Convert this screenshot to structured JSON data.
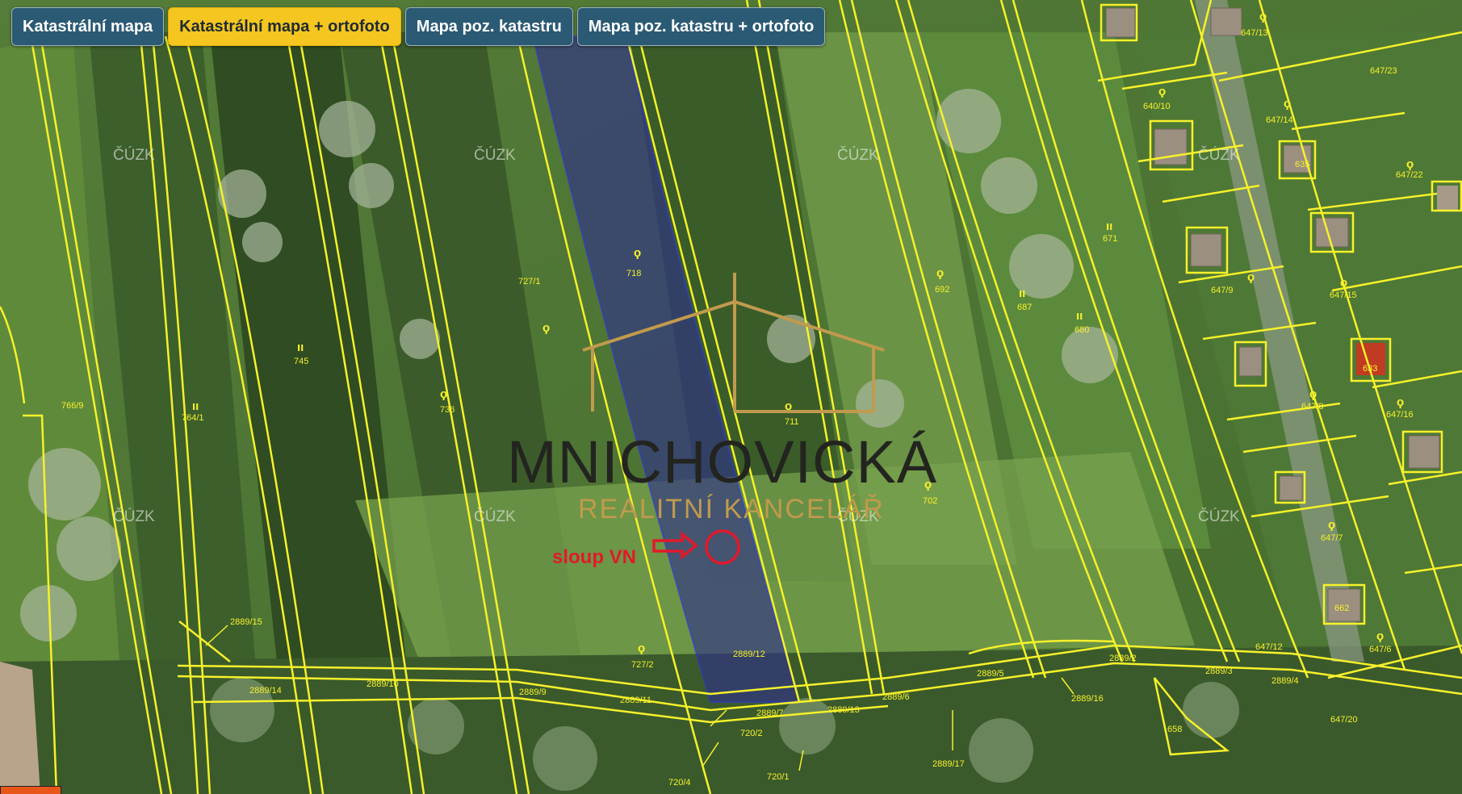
{
  "tabs": [
    {
      "label": "Katastrální mapa",
      "active": false
    },
    {
      "label": "Katastrální mapa + ortofoto",
      "active": true
    },
    {
      "label": "Mapa poz. katastru",
      "active": false
    },
    {
      "label": "Mapa poz. katastru + ortofoto",
      "active": false
    }
  ],
  "watermark": {
    "title": "MNICHOVICKÁ",
    "subtitle": "REALITNÍ KANCELÁŘ",
    "gold_color": "#c19a4d",
    "dark_color": "#23241f"
  },
  "annotation": {
    "label": "sloup VN",
    "color": "#e2192a"
  },
  "map_watermark_text": "ČÚZK",
  "colors": {
    "parcel_line": "#f6f12a",
    "highlight_fill": "#2e2f8c",
    "tab_bg": "#2b5a74",
    "tab_active_bg": "#f4c61f"
  },
  "parcel_labels": [
    "766/9",
    "764/1",
    "745",
    "736",
    "727/1",
    "718",
    "711",
    "702",
    "692",
    "687",
    "680",
    "671",
    "647/9",
    "647/15",
    "647/8",
    "647/16",
    "647/7",
    "647/6",
    "647/12",
    "647/20",
    "647/13",
    "647/14",
    "647/22",
    "647/23",
    "640/10",
    "635",
    "633",
    "662",
    "658",
    "727/2",
    "720/2",
    "720/1",
    "720/4",
    "2889/15",
    "2889/14",
    "2889/10",
    "2889/9",
    "2889/11",
    "2889/12",
    "2889/7",
    "2889/13",
    "2889/16",
    "2889/6",
    "2889/5",
    "2889/17",
    "2889/3",
    "2889/4",
    "2889/2"
  ]
}
